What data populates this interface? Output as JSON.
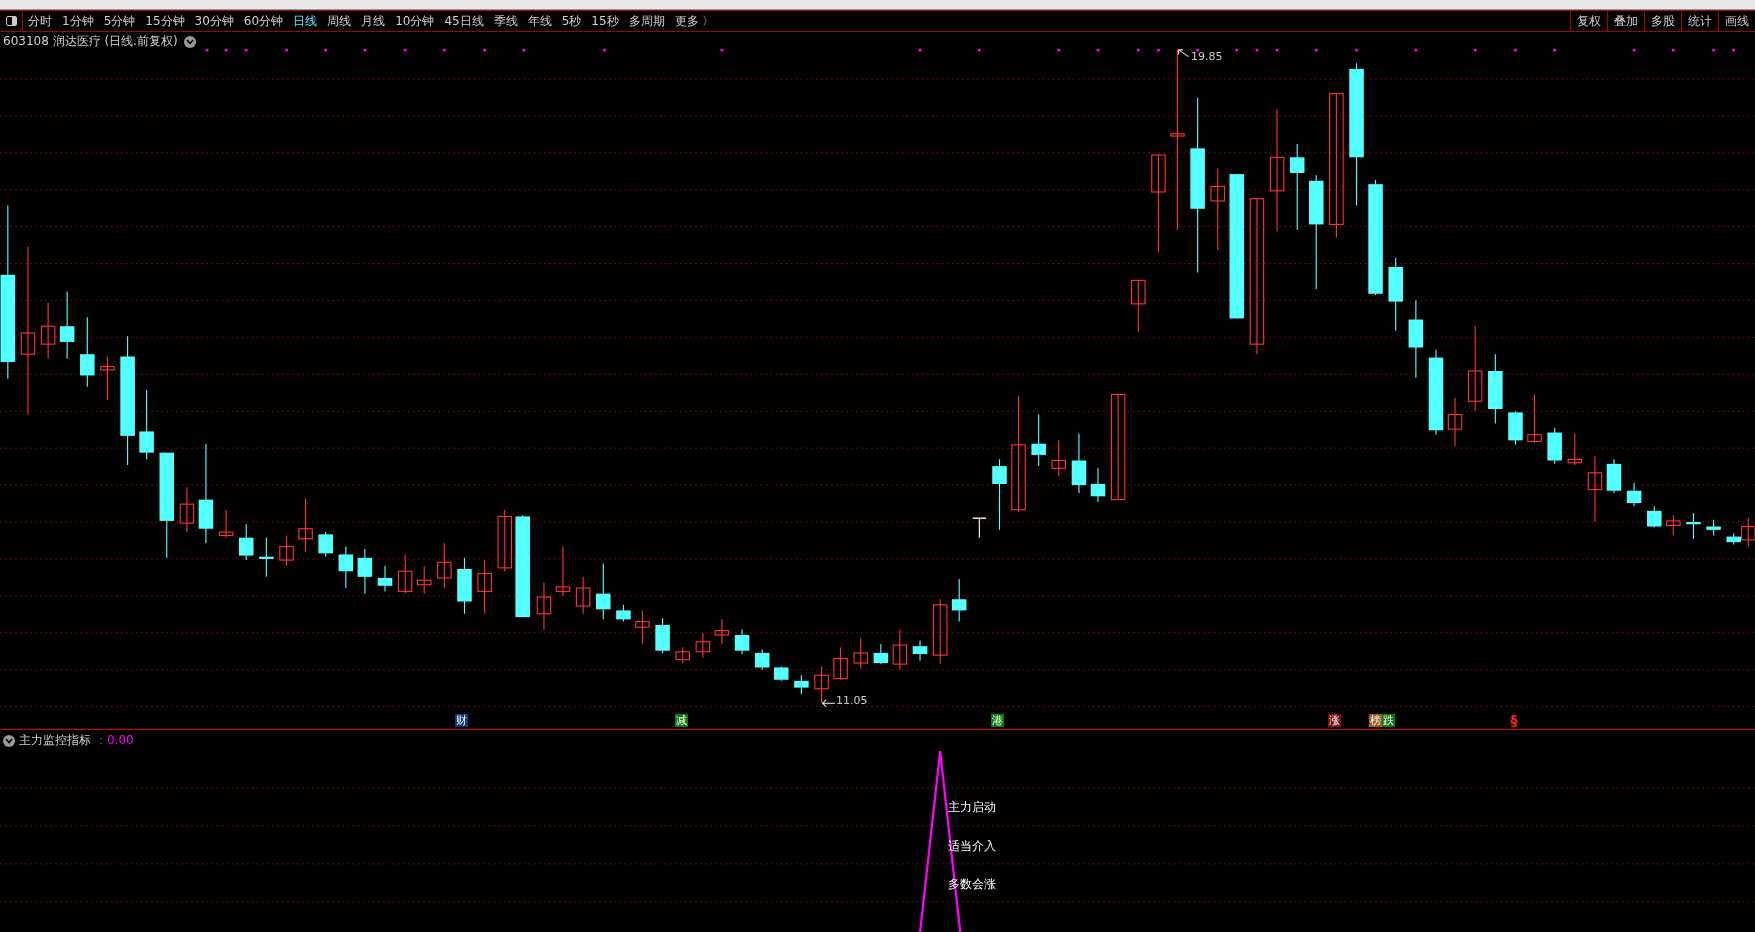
{
  "toolbar": {
    "periods": [
      {
        "label": "分时",
        "selected": false
      },
      {
        "label": "1分钟",
        "selected": false
      },
      {
        "label": "5分钟",
        "selected": false
      },
      {
        "label": "15分钟",
        "selected": false
      },
      {
        "label": "30分钟",
        "selected": false
      },
      {
        "label": "60分钟",
        "selected": false
      },
      {
        "label": "日线",
        "selected": true
      },
      {
        "label": "周线",
        "selected": false
      },
      {
        "label": "月线",
        "selected": false
      },
      {
        "label": "10分钟",
        "selected": false
      },
      {
        "label": "45日线",
        "selected": false
      },
      {
        "label": "季线",
        "selected": false
      },
      {
        "label": "年线",
        "selected": false
      },
      {
        "label": "5秒",
        "selected": false
      },
      {
        "label": "15秒",
        "selected": false
      },
      {
        "label": "多周期",
        "selected": false
      },
      {
        "label": "更多 〉",
        "selected": false
      }
    ],
    "tools": [
      "复权",
      "叠加",
      "多股",
      "统计",
      "画线"
    ]
  },
  "stock": {
    "title": "603108 润达医疗 (日线.前复权)"
  },
  "price_chart": {
    "high_label": "19.85",
    "low_label": "11.05",
    "event_markers": [
      {
        "label": "财",
        "kind": "badge",
        "color": "#123a7a"
      },
      {
        "label": "减",
        "kind": "badge",
        "color": "#0c7a0c"
      },
      {
        "label": "港",
        "kind": "badge",
        "color": "#0c7a0c"
      },
      {
        "label": "涨",
        "kind": "badge",
        "color": "#7a1010"
      },
      {
        "label": "榜",
        "kind": "badge",
        "color": "#a0561c"
      },
      {
        "label": "跌",
        "kind": "badge",
        "color": "#0c7a0c"
      },
      {
        "label": "§",
        "kind": "glyph",
        "color": "#ff2020"
      }
    ]
  },
  "indicator": {
    "name": "主力监控指标",
    "value_label": "：0.00",
    "signal_texts": [
      "主力启动",
      "适当介入",
      "多数会涨"
    ]
  }
}
